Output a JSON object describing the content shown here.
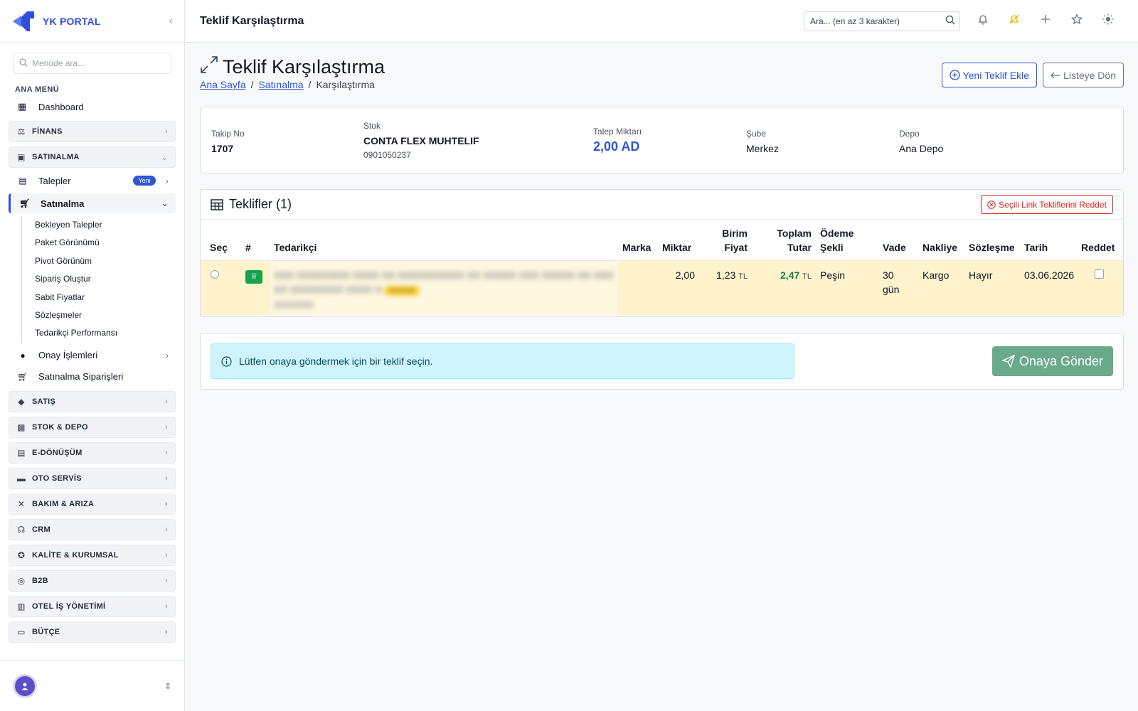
{
  "brand": {
    "name": "YK PORTAL"
  },
  "sidebar": {
    "search_placeholder": "Menüde ara...",
    "section_label": "ANA MENÜ",
    "dashboard": "Dashboard",
    "groups": [
      {
        "label": "FİNANS",
        "icon": "finance-icon"
      },
      {
        "label": "SATINALMA",
        "icon": "bag-icon"
      }
    ],
    "satinalma_items": {
      "talepler": "Talepler",
      "talepler_badge": "Yeni",
      "satinalma": "Satınalma",
      "leaves": [
        "Bekleyen Talepler",
        "Paket Görünümü",
        "Pivot Görünüm",
        "Sipariş Oluştur",
        "Sabit Fiyatlar",
        "Sözleşmeler",
        "Tedarikçi Performansı"
      ],
      "onay": "Onay İşlemleri",
      "siparisler": "Satınalma Siparişleri"
    },
    "more_groups": [
      "SATIŞ",
      "STOK & DEPO",
      "E-DÖNÜŞÜM",
      "OTO SERVİS",
      "BAKIM & ARIZA",
      "CRM",
      "KALİTE & KURUMSAL",
      "B2B",
      "OTEL İŞ YÖNETİMİ",
      "BÜTÇE"
    ]
  },
  "topbar": {
    "title": "Teklif Karşılaştırma",
    "search_placeholder": "Ara... (en az 3 karakter)"
  },
  "page": {
    "title": "Teklif Karşılaştırma",
    "breadcrumb": [
      "Ana Sayfa",
      "Satınalma",
      "Karşılaştırma"
    ],
    "new_offer_btn": "Yeni Teklif Ekle",
    "back_btn": "Listeye Dön"
  },
  "info": {
    "takip_label": "Takip No",
    "takip_value": "1707",
    "stok_label": "Stok",
    "stok_value": "CONTA FLEX MUHTELIF",
    "stok_code": "0901050237",
    "talep_label": "Talep Miktarı",
    "talep_value": "2,00 AD",
    "sube_label": "Şube",
    "sube_value": "Merkez",
    "depo_label": "Depo",
    "depo_value": "Ana Depo"
  },
  "offers": {
    "title": "Teklifler (1)",
    "reject_btn": "Seçili Link Tekliflerini Reddet",
    "columns": {
      "sec": "Seç",
      "no": "#",
      "tedarikci": "Tedarikçi",
      "marka": "Marka",
      "miktar": "Miktar",
      "birim_1": "Birim",
      "birim_2": "Fiyat",
      "toplam_1": "Toplam",
      "toplam_2": "Tutar",
      "odeme_1": "Ödeme",
      "odeme_2": "Şekli",
      "vade": "Vade",
      "nakliye": "Nakliye",
      "sozlesme": "Sözleşme",
      "tarih": "Tarih",
      "reddet": "Reddet"
    },
    "rows": [
      {
        "supplier_line1": "XXX XXXXXXXX XXXX XX XXXXXXXXXX XX XXXXX XXX XXXXX XX XXX",
        "supplier_line2": "XX XXXXXXXX XXXX X",
        "supplier_tag": "XXXXX",
        "supplier_line3": "XXXXXXX",
        "marka": "",
        "miktar": "2,00",
        "birim_fiyat": "1,23",
        "currency": "TL",
        "toplam": "2,47",
        "odeme": "Peşin",
        "vade_1": "30",
        "vade_2": "gün",
        "nakliye": "Kargo",
        "sozlesme": "Hayır",
        "tarih": "03.06.2026"
      }
    ]
  },
  "approval": {
    "info_text": "Lütfen onaya göndermek için bir teklif seçin.",
    "submit_btn": "Onaya Gönder"
  },
  "colors": {
    "primary": "#2f56d4",
    "row_highlight": "#fff3cd",
    "success": "#6aa98a",
    "danger": "#dc2626",
    "info_bg": "#cff4fc"
  }
}
